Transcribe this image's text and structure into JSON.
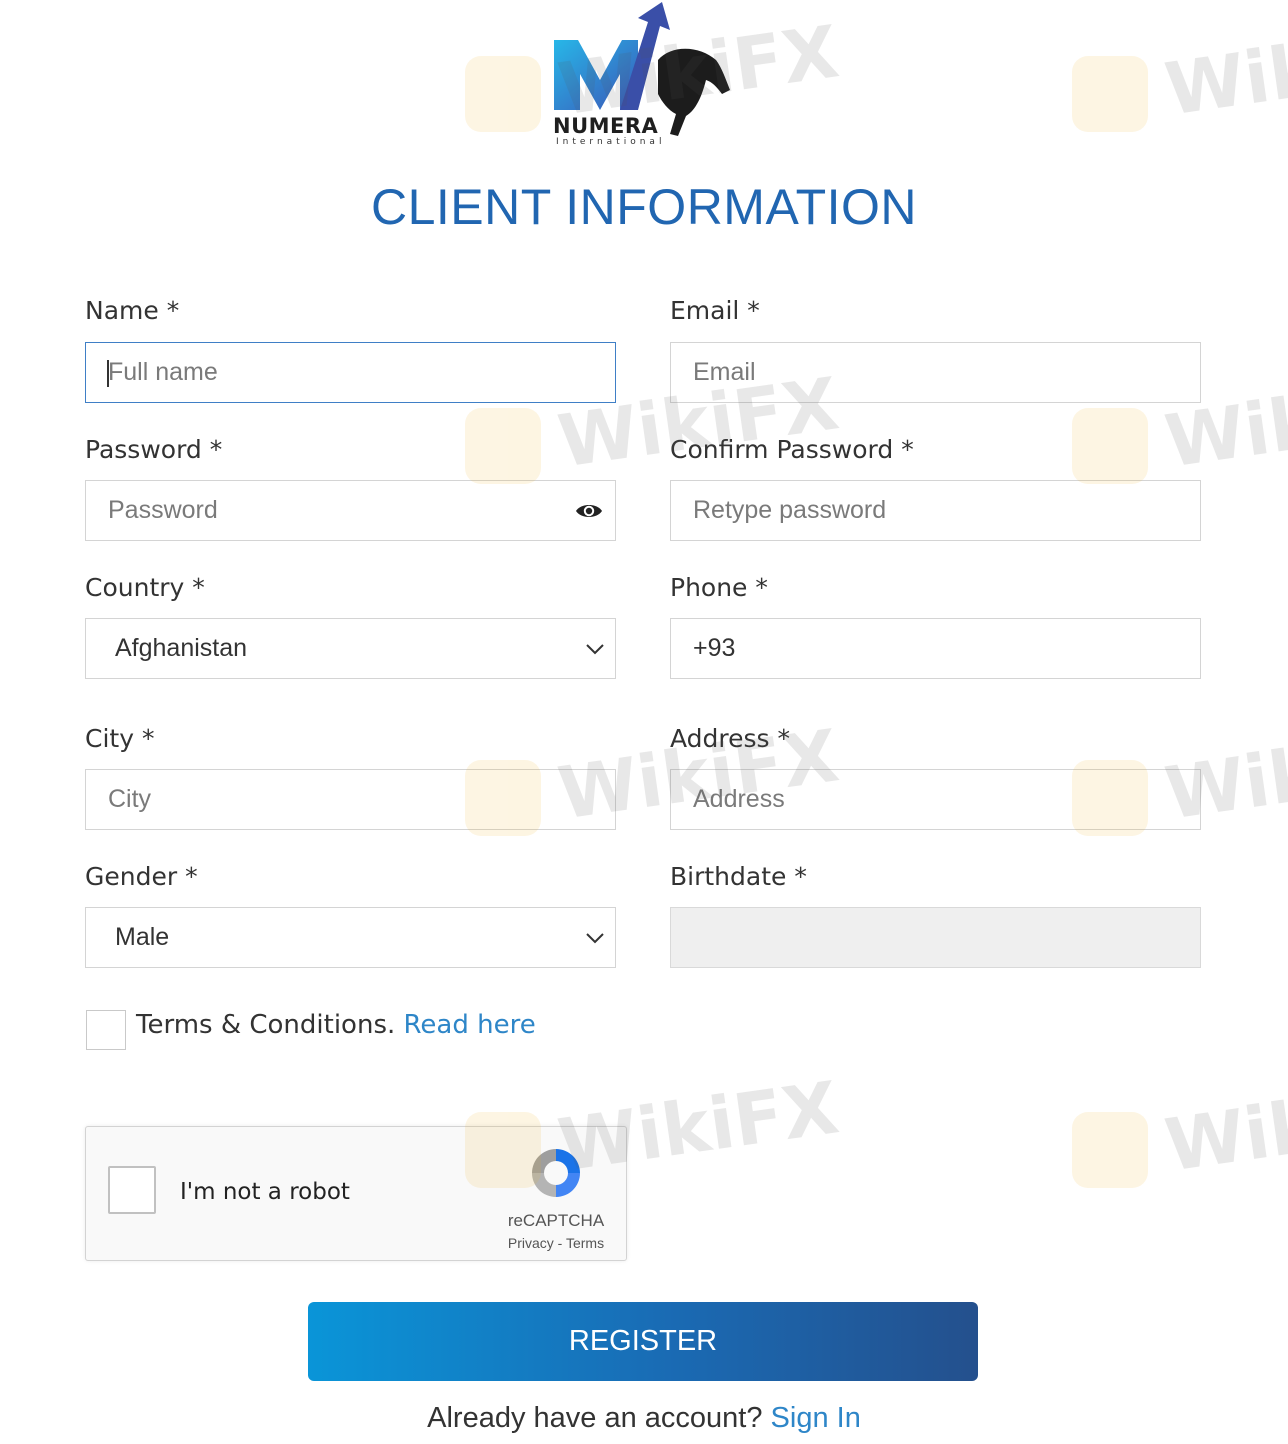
{
  "brand": {
    "name": "NUMERA",
    "sub": "International"
  },
  "title": "CLIENT INFORMATION",
  "form": {
    "name": {
      "label": "Name *",
      "placeholder": "Full name"
    },
    "email": {
      "label": "Email *",
      "placeholder": "Email"
    },
    "password": {
      "label": "Password *",
      "placeholder": "Password",
      "icon": "eye-icon"
    },
    "confirm_password": {
      "label": "Confirm Password *",
      "placeholder": "Retype password"
    },
    "country": {
      "label": "Country *",
      "value": "Afghanistan"
    },
    "phone": {
      "label": "Phone *",
      "value": "+93"
    },
    "city": {
      "label": "City *",
      "placeholder": "City"
    },
    "address": {
      "label": "Address *",
      "placeholder": "Address"
    },
    "gender": {
      "label": "Gender *",
      "value": "Male"
    },
    "birthdate": {
      "label": "Birthdate *",
      "value": ""
    }
  },
  "terms": {
    "text": "Terms & Conditions.",
    "link": "Read here",
    "checked": false
  },
  "captcha": {
    "label": "I'm not a robot",
    "brand": "reCAPTCHA",
    "privacy": "Privacy",
    "separator": " - ",
    "terms": "Terms"
  },
  "register_label": "REGISTER",
  "signin": {
    "text": "Already have an account?",
    "link": "Sign In"
  },
  "watermark": {
    "text": "WikiFX"
  },
  "colors": {
    "title": "#2166b1",
    "link": "#2e86c8",
    "button_start": "#0a95d8",
    "button_end": "#24508d"
  }
}
